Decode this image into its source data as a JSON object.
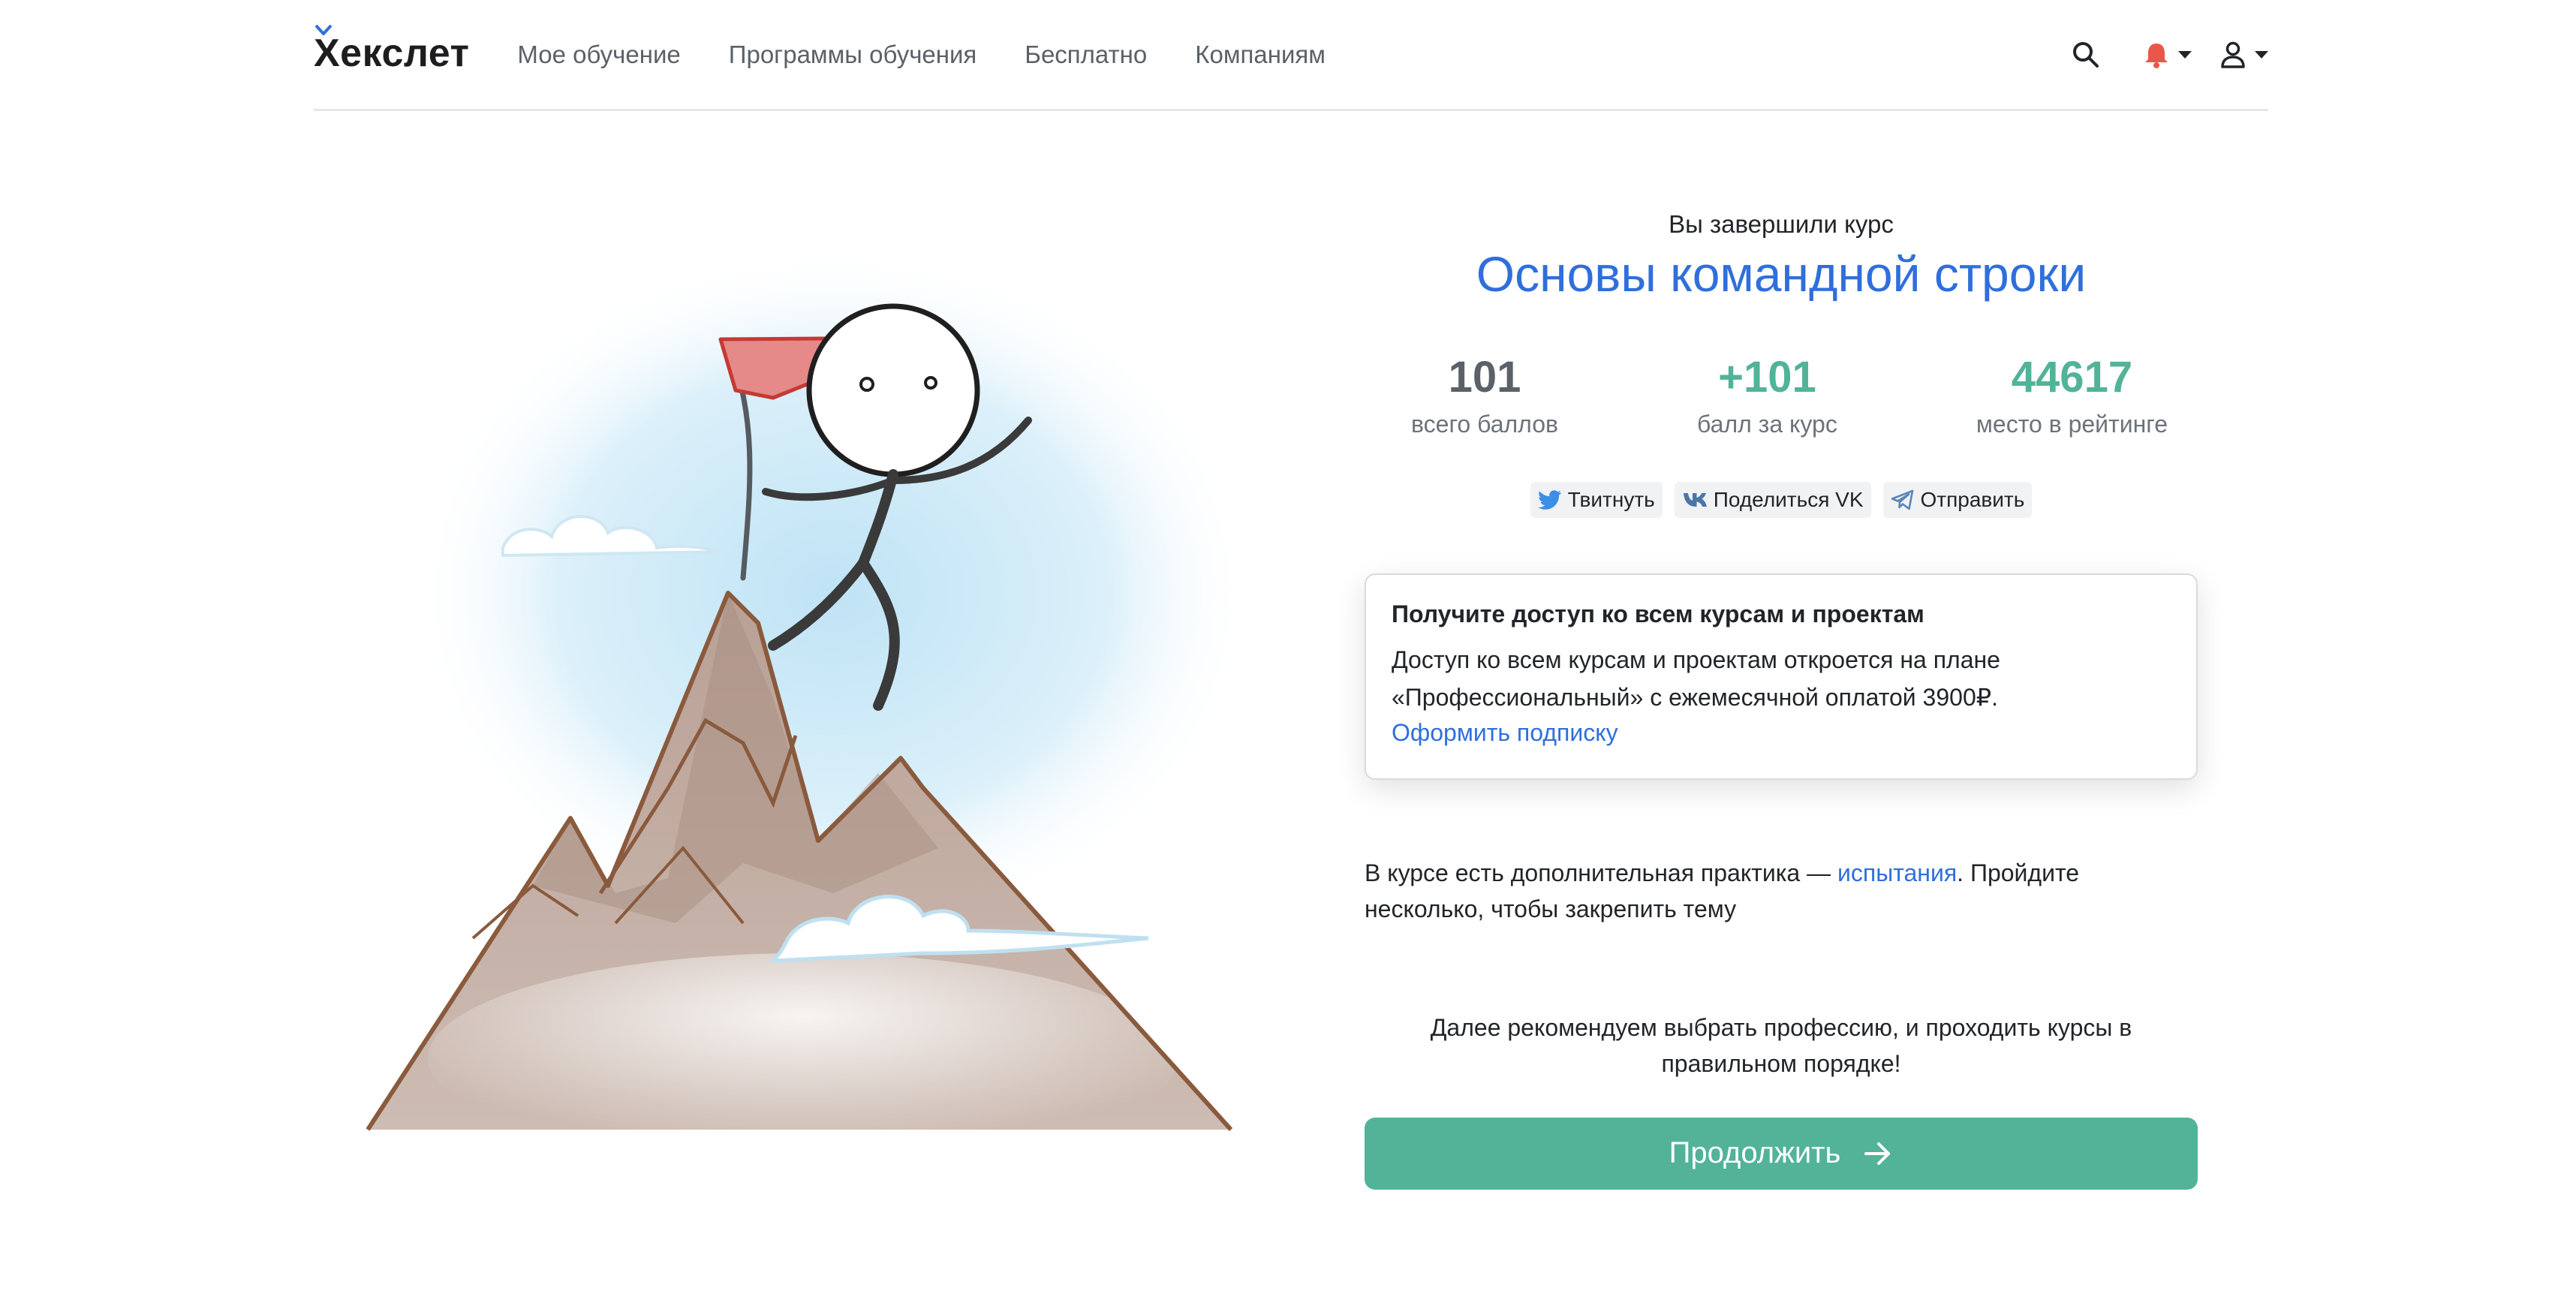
{
  "brand": {
    "logo": "Хекслет",
    "accent": "#2f6fdc",
    "success": "#52b398",
    "notify": "#e8574a"
  },
  "nav": {
    "items": [
      {
        "label": "Мое обучение"
      },
      {
        "label": "Программы обучения"
      },
      {
        "label": "Бесплатно"
      },
      {
        "label": "Компаниям"
      }
    ]
  },
  "header_icons": [
    "search-icon",
    "bell-icon",
    "user-icon"
  ],
  "completion": {
    "label": "Вы завершили курс",
    "course_title": "Основы командной строки"
  },
  "stats": [
    {
      "value": "101",
      "label": "всего баллов"
    },
    {
      "value": "+101",
      "label": "балл за курс"
    },
    {
      "value": "44617",
      "label": "место в рейтинге"
    }
  ],
  "share": {
    "twitter": "Твитнуть",
    "vk": "Поделиться VK",
    "telegram": "Отправить"
  },
  "subscription": {
    "title": "Получите доступ ко всем курсам и проектам",
    "text": "Доступ ко всем курсам и проектам откроется на плане «Профессиональный» с ежемесячной оплатой 3900₽.",
    "link": "Оформить подписку"
  },
  "practice": {
    "before": "В курсе есть дополнительная практика — ",
    "link": "испытания",
    "after": ". Пройдите несколько, чтобы закрепить тему"
  },
  "recommend": "Далее рекомендуем выбрать профессию, и проходить курсы в правильном порядке!",
  "continue_button": "Продолжить"
}
